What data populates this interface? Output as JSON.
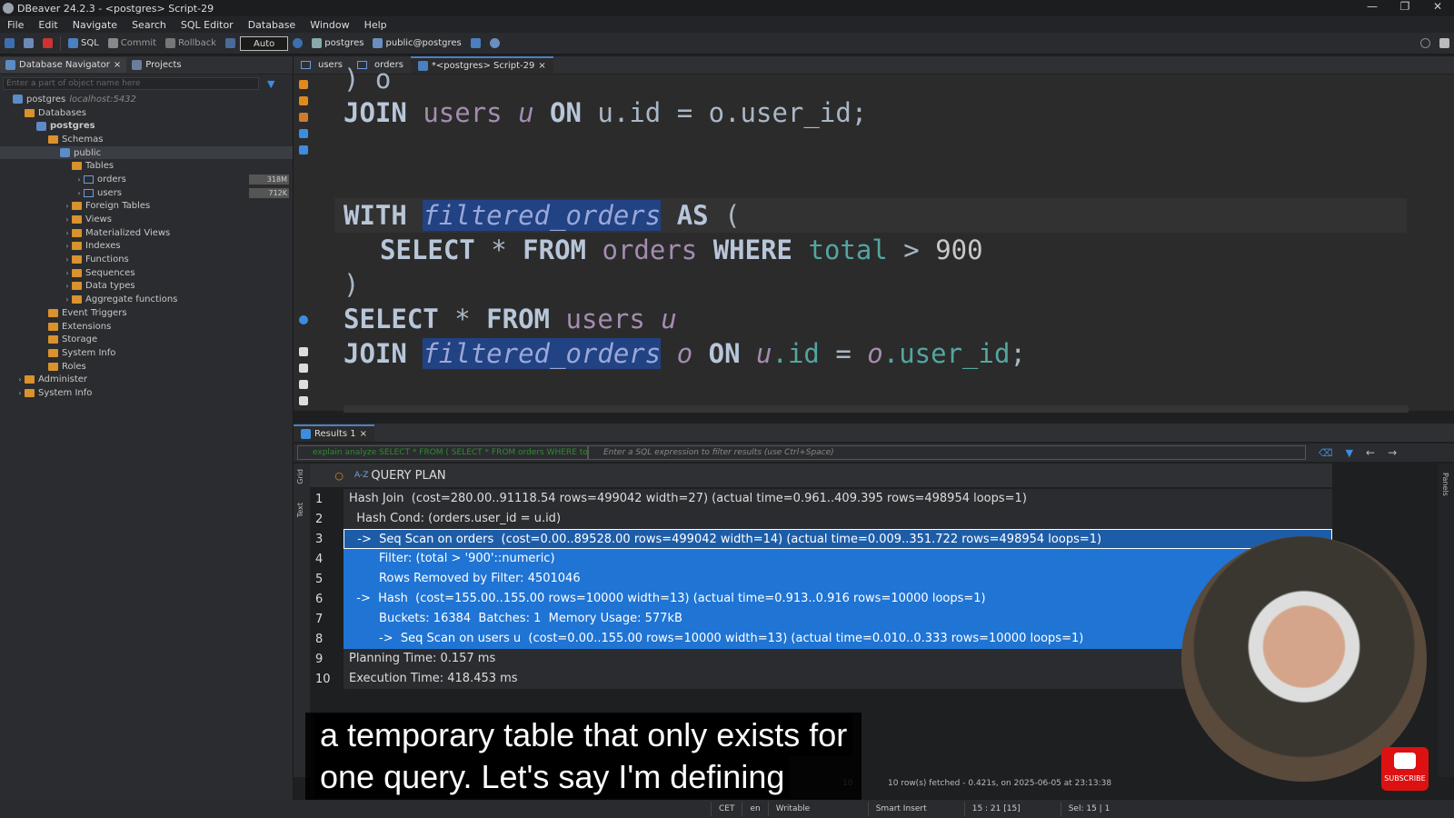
{
  "window": {
    "title": "DBeaver 24.2.3 - <postgres> Script-29",
    "controls": [
      "—",
      "❐",
      "✕"
    ]
  },
  "menu": [
    "File",
    "Edit",
    "Navigate",
    "Search",
    "SQL Editor",
    "Database",
    "Window",
    "Help"
  ],
  "toolbar": {
    "sql": "SQL",
    "commit": "Commit",
    "rollback": "Rollback",
    "mode": "Auto",
    "datasource": "postgres",
    "schema": "public@postgres"
  },
  "navigator": {
    "tabs": [
      "Database Navigator",
      "Projects"
    ],
    "filter_placeholder": "Enter a part of object name here",
    "tree": [
      {
        "label": "postgres",
        "sub": "localhost:5432",
        "level": 0,
        "type": "db"
      },
      {
        "label": "Databases",
        "level": 1,
        "type": "folder"
      },
      {
        "label": "postgres",
        "level": 2,
        "type": "db",
        "bold": true
      },
      {
        "label": "Schemas",
        "level": 3,
        "type": "folder"
      },
      {
        "label": "public",
        "level": 4,
        "type": "db",
        "selected": true
      },
      {
        "label": "Tables",
        "level": 5,
        "type": "folder"
      },
      {
        "label": "orders",
        "level": 6,
        "type": "table",
        "size": "318M"
      },
      {
        "label": "users",
        "level": 6,
        "type": "table",
        "size": "712K"
      },
      {
        "label": "Foreign Tables",
        "level": 5,
        "type": "folder"
      },
      {
        "label": "Views",
        "level": 5,
        "type": "folder"
      },
      {
        "label": "Materialized Views",
        "level": 5,
        "type": "folder"
      },
      {
        "label": "Indexes",
        "level": 5,
        "type": "folder"
      },
      {
        "label": "Functions",
        "level": 5,
        "type": "folder"
      },
      {
        "label": "Sequences",
        "level": 5,
        "type": "folder"
      },
      {
        "label": "Data types",
        "level": 5,
        "type": "folder"
      },
      {
        "label": "Aggregate functions",
        "level": 5,
        "type": "folder"
      },
      {
        "label": "Event Triggers",
        "level": 3,
        "type": "folder"
      },
      {
        "label": "Extensions",
        "level": 3,
        "type": "folder"
      },
      {
        "label": "Storage",
        "level": 3,
        "type": "folder"
      },
      {
        "label": "System Info",
        "level": 3,
        "type": "folder"
      },
      {
        "label": "Roles",
        "level": 3,
        "type": "folder"
      },
      {
        "label": "Administer",
        "level": 1,
        "type": "folder"
      },
      {
        "label": "System Info",
        "level": 1,
        "type": "folder"
      }
    ]
  },
  "editor_tabs": [
    "users",
    "orders",
    "*<postgres> Script-29"
  ],
  "code": {
    "l0": ") o",
    "l1": {
      "k1": "JOIN",
      "t": "users",
      "a": "u",
      "k2": "ON",
      "rest": "u.id = o.user_id;"
    },
    "l2": {
      "k1": "WITH",
      "cte": "filtered_orders",
      "k2": "AS",
      "p": "("
    },
    "l3": {
      "k1": "SELECT",
      "star": "*",
      "k2": "FROM",
      "t": "orders",
      "k3": "WHERE",
      "c": "total",
      "op": ">",
      "n": "900"
    },
    "l4": ")",
    "l5": {
      "k1": "SELECT",
      "star": "*",
      "k2": "FROM",
      "t": "users",
      "a": "u"
    },
    "l6": {
      "k1": "JOIN",
      "cte": "filtered_orders",
      "a": "o",
      "k2": "ON",
      "a1": "u",
      "c1": ".id",
      "eq": "=",
      "a2": "o",
      "c2": ".user_id",
      "end": ";"
    }
  },
  "results": {
    "tab": "Results 1",
    "query_text": "explain analyze SELECT * FROM ( SELECT * FROM orders WHERE tot",
    "filter_placeholder": "Enter a SQL expression to filter results (use Ctrl+Space)",
    "column": "QUERY PLAN",
    "rows": [
      "Hash Join  (cost=280.00..91118.54 rows=499042 width=27) (actual time=0.961..409.395 rows=498954 loops=1)",
      "  Hash Cond: (orders.user_id = u.id)",
      "  ->  Seq Scan on orders  (cost=0.00..89528.00 rows=499042 width=14) (actual time=0.009..351.722 rows=498954 loops=1)",
      "        Filter: (total > '900'::numeric)",
      "        Rows Removed by Filter: 4501046",
      "  ->  Hash  (cost=155.00..155.00 rows=10000 width=13) (actual time=0.913..0.916 rows=10000 loops=1)",
      "        Buckets: 16384  Batches: 1  Memory Usage: 577kB",
      "        ->  Seq Scan on users u  (cost=0.00..155.00 rows=10000 width=13) (actual time=0.010..0.333 rows=10000 loops=1)",
      "Planning Time: 0.157 ms",
      "Execution Time: 418.453 ms"
    ],
    "fetch_limit": "10",
    "fetch_status": "10 row(s) fetched - 0.421s, on 2025-06-05 at 23:13:38"
  },
  "status": [
    "CET",
    "en",
    "Writable",
    "Smart Insert",
    "15 : 21 [15]",
    "Sel: 15 | 1"
  ],
  "subtitle": [
    "a temporary table that only exists for",
    "one query. Let's say I'm defining"
  ],
  "subscribe": "SUBSCRIBE"
}
